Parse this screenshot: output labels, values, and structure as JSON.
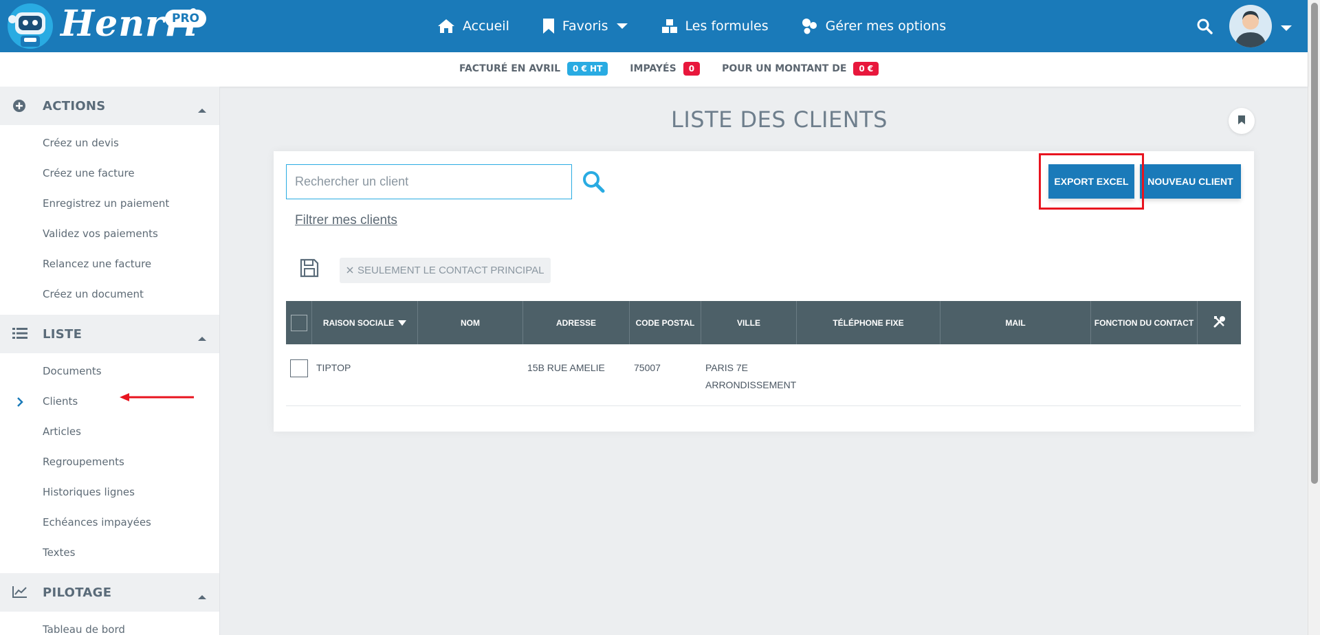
{
  "header": {
    "brand": "Henrri",
    "pro_label": "PRO",
    "nav": [
      {
        "label": "Accueil",
        "icon": "home-icon"
      },
      {
        "label": "Favoris",
        "icon": "bookmark-icon"
      },
      {
        "label": "Les formules",
        "icon": "cubes-icon"
      },
      {
        "label": "Gérer mes options",
        "icon": "options-icon"
      }
    ]
  },
  "stats": {
    "invoiced_label": "FACTURÉ EN AVRIL",
    "invoiced_value": "0 € HT",
    "unpaid_label": "IMPAYÉS",
    "unpaid_value": "0",
    "amount_label": "POUR UN MONTANT DE",
    "amount_value": "0 €"
  },
  "sidebar": {
    "sections": [
      {
        "title": "ACTIONS",
        "icon": "plus-circle-icon",
        "items": [
          "Créez un devis",
          "Créez une facture",
          "Enregistrez un paiement",
          "Validez vos paiements",
          "Relancez une facture",
          "Créez un document"
        ]
      },
      {
        "title": "LISTE",
        "icon": "list-icon",
        "items": [
          "Documents",
          "Clients",
          "Articles",
          "Regroupements",
          "Historiques lignes",
          "Echéances impayées",
          "Textes"
        ]
      },
      {
        "title": "PILOTAGE",
        "icon": "chart-line-icon",
        "items": [
          "Tableau de bord"
        ]
      }
    ],
    "active_item": "Clients"
  },
  "main": {
    "title": "LISTE DES CLIENTS",
    "search_placeholder": "Rechercher un client",
    "filter_link": "Filtrer mes clients",
    "export_button": "EXPORT EXCEL",
    "new_client_button": "NOUVEAU CLIENT",
    "filter_chip": "SEULEMENT LE CONTACT PRINCIPAL",
    "table": {
      "columns": [
        "RAISON SOCIALE",
        "NOM",
        "ADRESSE",
        "CODE POSTAL",
        "VILLE",
        "TÉLÉPHONE FIXE",
        "MAIL",
        "FONCTION DU CONTACT"
      ],
      "rows": [
        {
          "raison_sociale": "TIPTOP",
          "nom": "",
          "adresse": "15B RUE AMELIE",
          "code_postal": "75007",
          "ville": "PARIS 7E ARRONDISSEMENT",
          "telephone": "",
          "mail": "",
          "fonction": ""
        }
      ]
    }
  },
  "colors": {
    "primary": "#1a7ab9",
    "accent": "#29abe2",
    "danger": "#e8173c",
    "table_header": "#4d6068",
    "highlight": "#e8141f"
  }
}
